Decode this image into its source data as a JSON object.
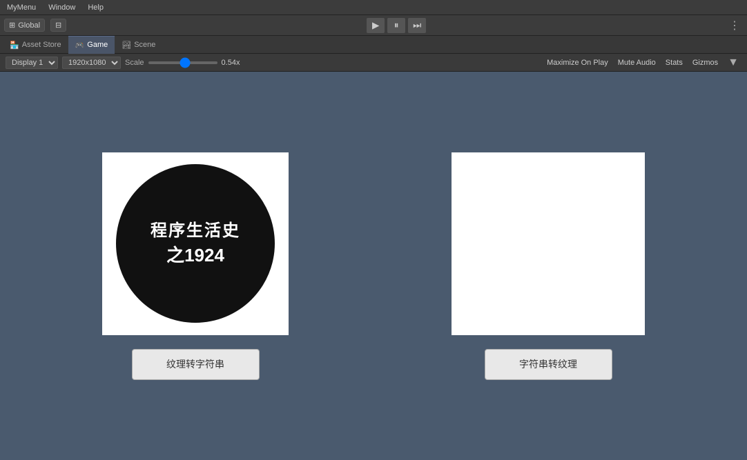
{
  "menu": {
    "items": [
      "MyMenu",
      "Window",
      "Help"
    ]
  },
  "toolbar": {
    "global_label": "Global",
    "global_icon": "⊞"
  },
  "tabs": [
    {
      "id": "asset-store",
      "icon": "🏪",
      "label": "Asset Store",
      "active": false
    },
    {
      "id": "game",
      "icon": "🎮",
      "label": "Game",
      "active": true
    },
    {
      "id": "scene",
      "icon": "🏞",
      "label": "Scene",
      "active": false
    }
  ],
  "display_bar": {
    "display_label": "Display 1",
    "resolution": "1920x1080",
    "scale_label": "Scale",
    "scale_value": "0.54x",
    "maximize_on_play": "Maximize On Play",
    "mute_audio": "Mute Audio",
    "stats": "Stats",
    "gizmos": "Gizmos"
  },
  "game_view": {
    "logo": {
      "line1": "程序生活史",
      "line2": "之1924"
    },
    "btn_left": "纹理转字符串",
    "btn_right": "字符串转纹理"
  }
}
